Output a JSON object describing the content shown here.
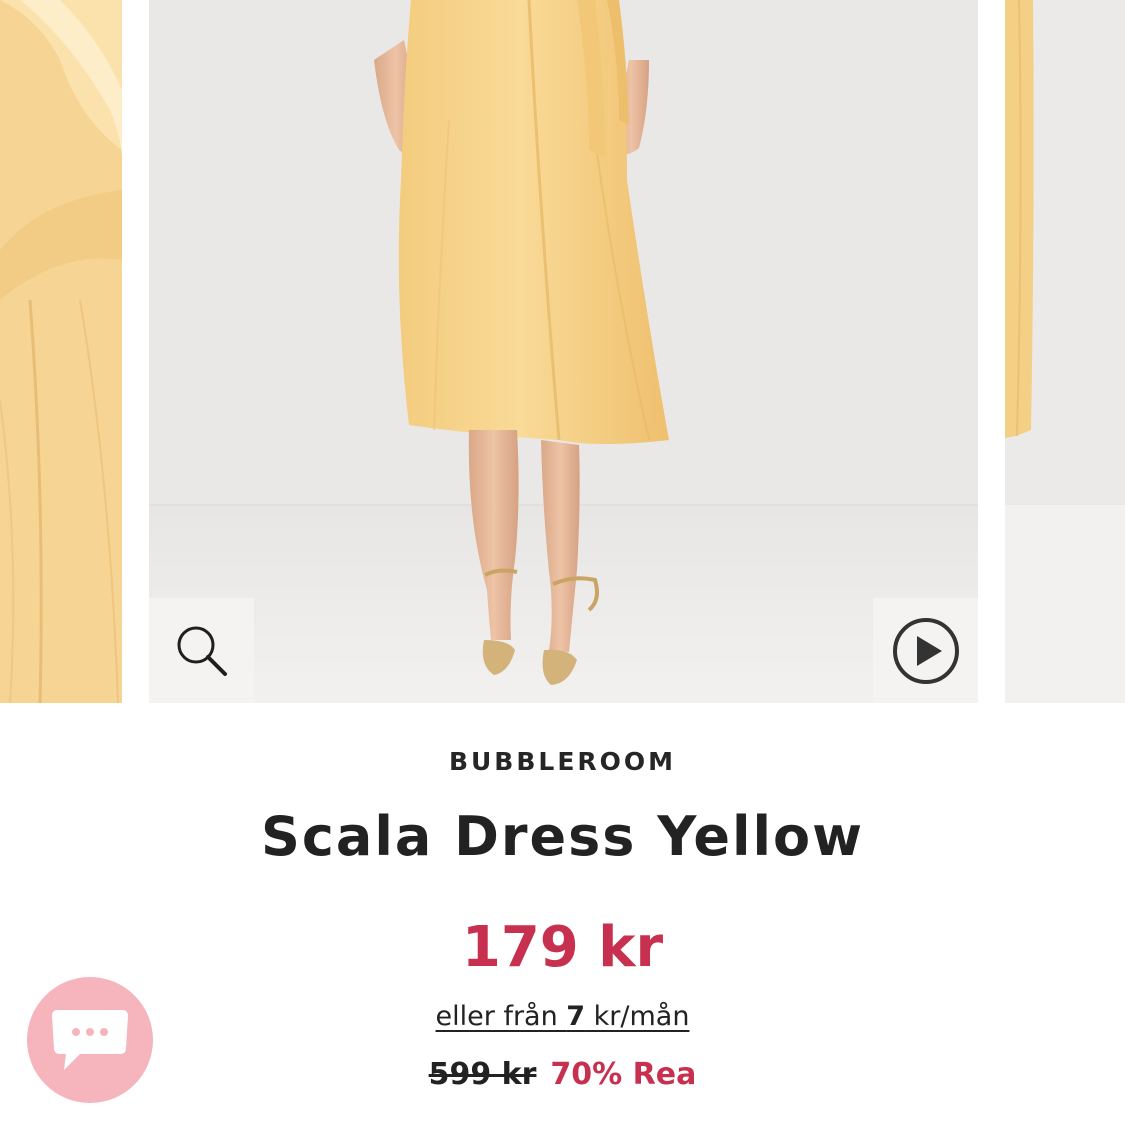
{
  "gallery": {
    "zoom_icon": "magnifier-icon",
    "play_icon": "play-circle-icon",
    "colors": {
      "dress": "#f5d38f",
      "backdrop": "#ecebe9",
      "button_bg": "#f4f3f1"
    }
  },
  "product": {
    "brand": "BUBBLEROOM",
    "title": "Scala Dress Yellow",
    "price": "179 kr",
    "installment": {
      "prefix": "eller från ",
      "amount": "7",
      "suffix": " kr/mån"
    },
    "original_price": "599 kr",
    "discount": "70% Rea"
  },
  "chat": {
    "icon": "chat-bubble-icon",
    "color": "#f6b5bd"
  },
  "colors": {
    "sale": "#c8304f",
    "text": "#222222"
  }
}
